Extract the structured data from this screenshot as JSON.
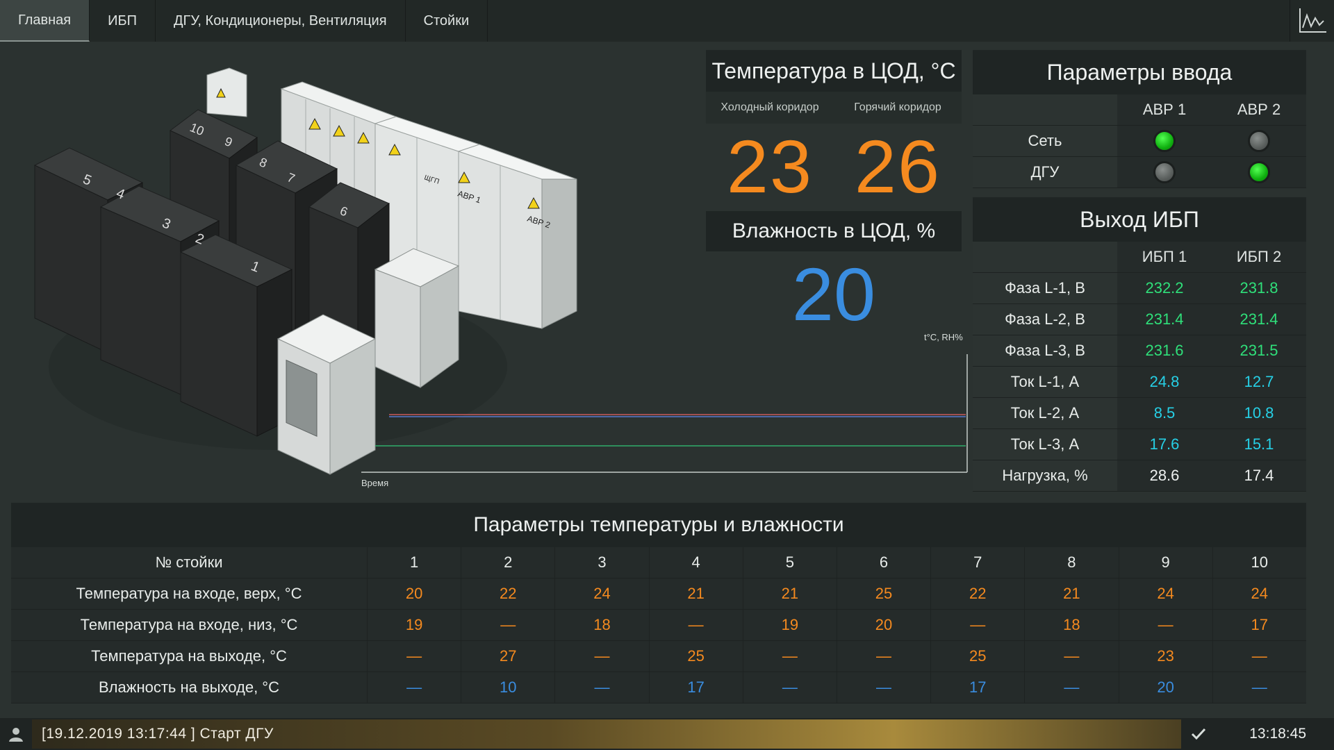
{
  "nav": {
    "tabs": [
      "Главная",
      "ИБП",
      "ДГУ, Кондиционеры, Вентиляция",
      "Стойки"
    ],
    "active": 0,
    "chart_icon": "line-chart-icon"
  },
  "scene": {
    "rack_labels": [
      "10",
      "9",
      "8",
      "7",
      "6",
      "5",
      "4",
      "3",
      "2",
      "1"
    ],
    "panel_labels": [
      "АВР 1",
      "АВР 2",
      "ЩГП"
    ]
  },
  "temp": {
    "title": "Температура в ЦОД, °С",
    "cold_label": "Холодный коридор",
    "hot_label": "Горячий коридор",
    "cold_value": "23",
    "hot_value": "26"
  },
  "humidity": {
    "title": "Влажность в ЦОД, %",
    "value": "20"
  },
  "trend": {
    "y_label": "t°С, RH%",
    "x_label": "Время",
    "series_colors": [
      "#c85a5a",
      "#5a7ad0",
      "#2fae6a"
    ]
  },
  "input": {
    "title": "Параметры ввода",
    "cols": [
      "АВР 1",
      "АВР 2"
    ],
    "rows": [
      {
        "label": "Сеть",
        "states": [
          "on",
          "off"
        ]
      },
      {
        "label": "ДГУ",
        "states": [
          "off",
          "on"
        ]
      }
    ]
  },
  "ups": {
    "title": "Выход ИБП",
    "cols": [
      "ИБП 1",
      "ИБП 2"
    ],
    "rows": [
      {
        "label": "Фаза L-1, В",
        "v1": "232.2",
        "v2": "231.8",
        "color": "green"
      },
      {
        "label": "Фаза L-2, В",
        "v1": "231.4",
        "v2": "231.4",
        "color": "green"
      },
      {
        "label": "Фаза L-3, В",
        "v1": "231.6",
        "v2": "231.5",
        "color": "green"
      },
      {
        "label": "Ток L-1, А",
        "v1": "24.8",
        "v2": "12.7",
        "color": "cyan"
      },
      {
        "label": "Ток L-2, А",
        "v1": "8.5",
        "v2": "10.8",
        "color": "cyan"
      },
      {
        "label": "Ток L-3, А",
        "v1": "17.6",
        "v2": "15.1",
        "color": "cyan"
      },
      {
        "label": "Нагрузка, %",
        "v1": "28.6",
        "v2": "17.4",
        "color": "white"
      }
    ]
  },
  "racks": {
    "title": "Параметры температуры и влажности",
    "header_label": "№ стойки",
    "numbers": [
      "1",
      "2",
      "3",
      "4",
      "5",
      "6",
      "7",
      "8",
      "9",
      "10"
    ],
    "rows": [
      {
        "label": "Температура на входе, верх, °С",
        "color": "orange",
        "values": [
          "20",
          "22",
          "24",
          "21",
          "21",
          "25",
          "22",
          "21",
          "24",
          "24"
        ]
      },
      {
        "label": "Температура на входе, низ, °С",
        "color": "orange",
        "values": [
          "19",
          "—",
          "18",
          "—",
          "19",
          "20",
          "—",
          "18",
          "—",
          "17"
        ]
      },
      {
        "label": "Температура на выходе, °С",
        "color": "orange",
        "values": [
          "—",
          "27",
          "—",
          "25",
          "—",
          "—",
          "25",
          "—",
          "23",
          "—"
        ]
      },
      {
        "label": "Влажность  на выходе, °С",
        "color": "blue",
        "values": [
          "—",
          "10",
          "—",
          "17",
          "—",
          "—",
          "17",
          "—",
          "20",
          "—"
        ]
      }
    ]
  },
  "status": {
    "message": "[19.12.2019  13:17:44 ]  Старт ДГУ",
    "clock": "13:18:45"
  }
}
